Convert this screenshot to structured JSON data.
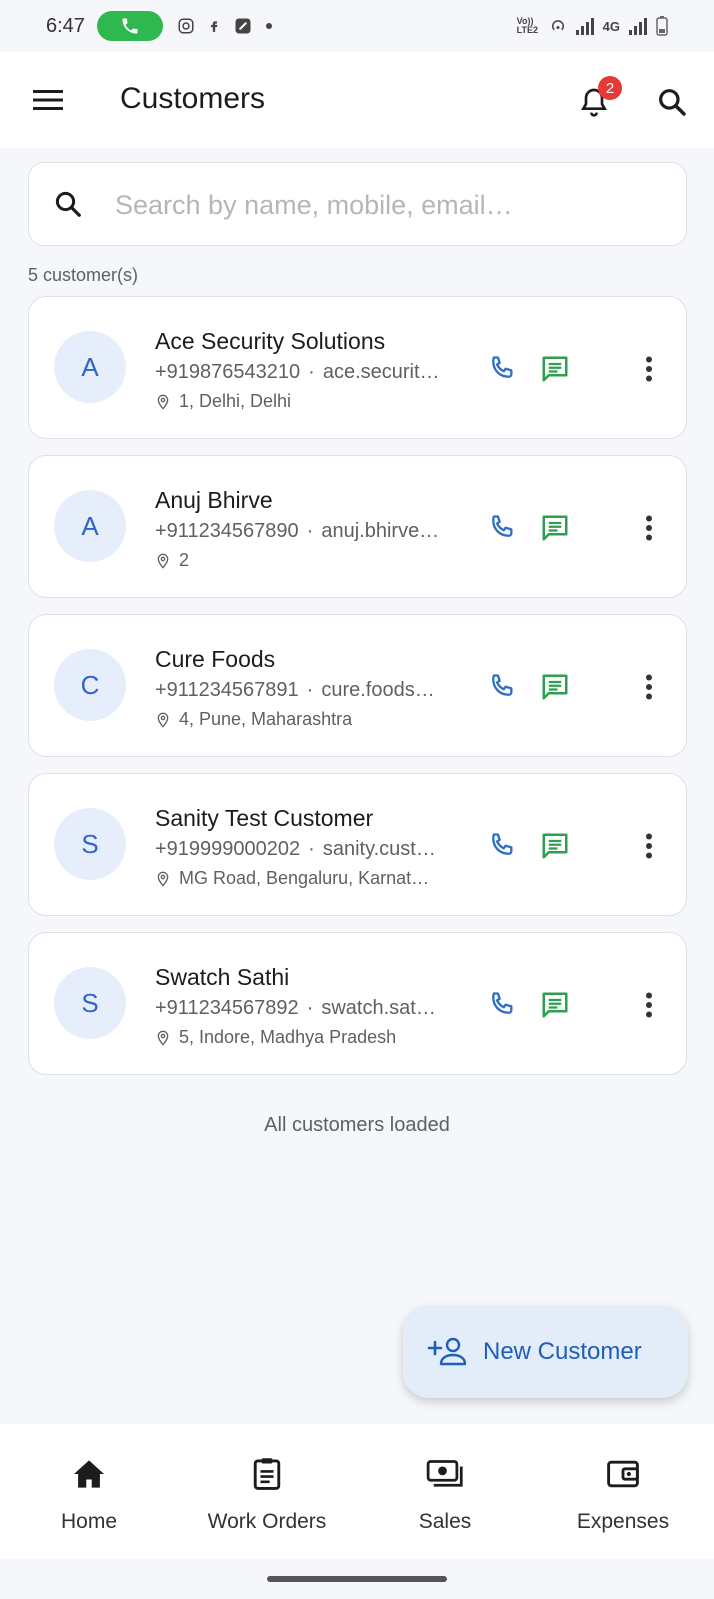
{
  "status_bar": {
    "time": "6:47",
    "network": "4G",
    "volte": "Vo)) LTE2"
  },
  "app_bar": {
    "title": "Customers",
    "notification_count": "2"
  },
  "search": {
    "placeholder": "Search by name, mobile, email…"
  },
  "customers_count": "5 customer(s)",
  "customers": [
    {
      "initial": "A",
      "name": "Ace Security Solutions",
      "phone": "+919876543210",
      "email": "ace.securit…",
      "address": "1, Delhi, Delhi"
    },
    {
      "initial": "A",
      "name": "Anuj Bhirve",
      "phone": "+911234567890",
      "email": "anuj.bhirve…",
      "address": "2"
    },
    {
      "initial": "C",
      "name": "Cure Foods",
      "phone": "+911234567891",
      "email": "cure.foods…",
      "address": "4, Pune, Maharashtra"
    },
    {
      "initial": "S",
      "name": "Sanity Test Customer",
      "phone": "+919999000202",
      "email": "sanity.cust…",
      "address": "MG Road, Bengaluru, Karnat…"
    },
    {
      "initial": "S",
      "name": "Swatch Sathi",
      "phone": "+911234567892",
      "email": "swatch.sat…",
      "address": "5, Indore, Madhya Pradesh"
    }
  ],
  "footer_text": "All customers loaded",
  "fab": {
    "label": "New Customer"
  },
  "bottom_nav": [
    {
      "label": "Home",
      "icon": "home-icon"
    },
    {
      "label": "Work Orders",
      "icon": "clipboard-icon"
    },
    {
      "label": "Sales",
      "icon": "cash-icon"
    },
    {
      "label": "Expenses",
      "icon": "wallet-icon"
    }
  ],
  "colors": {
    "accent": "#1f5fb8",
    "phone": "#2f6fc4",
    "sms": "#2e9e4f",
    "badge": "#e53935",
    "avatar_bg": "#e6eefb"
  }
}
